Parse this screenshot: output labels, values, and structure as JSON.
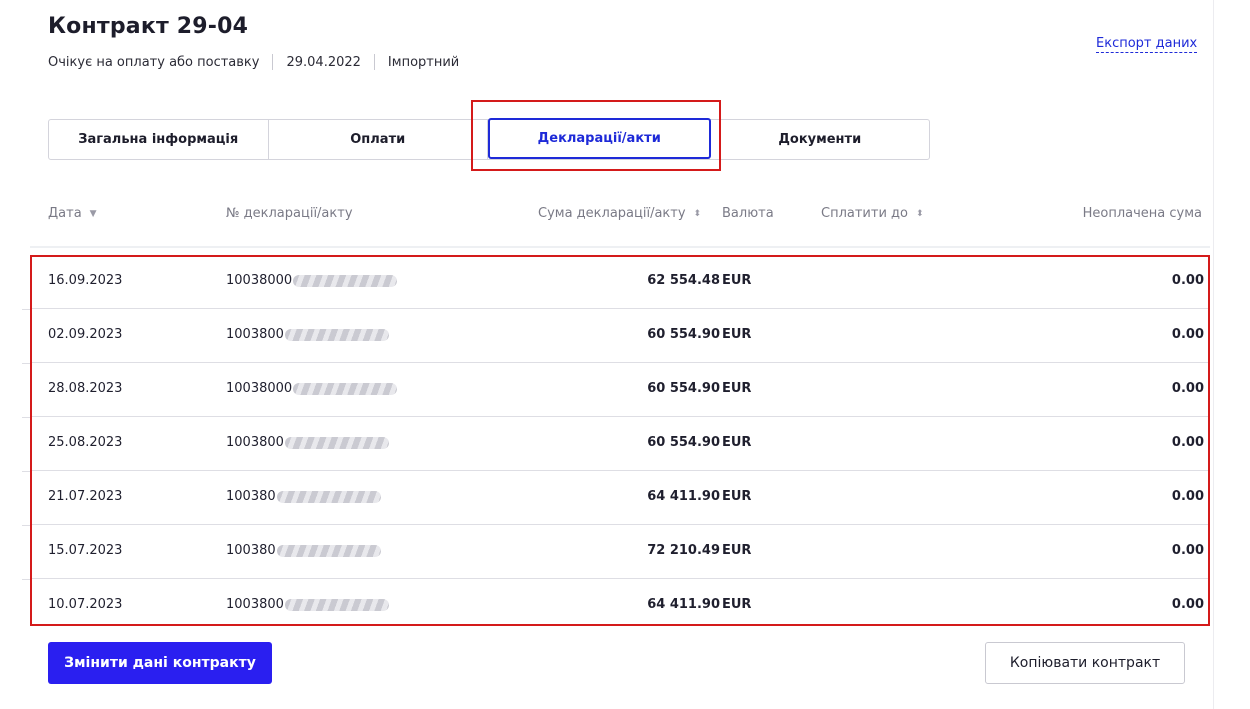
{
  "header": {
    "title": "Контракт 29-04",
    "status": "Очікує на оплату або поставку",
    "date": "29.04.2022",
    "type": "Імпортний",
    "export_label": "Експорт даних"
  },
  "tabs": [
    {
      "label": "Загальна інформація",
      "active": false
    },
    {
      "label": "Оплати",
      "active": false
    },
    {
      "label": "Декларації/акти",
      "active": true
    },
    {
      "label": "Документи",
      "active": false
    }
  ],
  "table": {
    "columns": {
      "date": "Дата",
      "number": "№ декларації/акту",
      "sum": "Сума декларації/акту",
      "currency": "Валюта",
      "pay_until": "Сплатити до",
      "unpaid": "Неоплачена сума"
    },
    "rows": [
      {
        "date": "16.09.2023",
        "number_prefix": "10038000",
        "sum": "62 554.48",
        "currency": "EUR",
        "pay_until": "",
        "unpaid": "0.00"
      },
      {
        "date": "02.09.2023",
        "number_prefix": "1003800",
        "sum": "60 554.90",
        "currency": "EUR",
        "pay_until": "",
        "unpaid": "0.00"
      },
      {
        "date": "28.08.2023",
        "number_prefix": "10038000",
        "sum": "60 554.90",
        "currency": "EUR",
        "pay_until": "",
        "unpaid": "0.00"
      },
      {
        "date": "25.08.2023",
        "number_prefix": "1003800",
        "sum": "60 554.90",
        "currency": "EUR",
        "pay_until": "",
        "unpaid": "0.00"
      },
      {
        "date": "21.07.2023",
        "number_prefix": "100380",
        "sum": "64 411.90",
        "currency": "EUR",
        "pay_until": "",
        "unpaid": "0.00"
      },
      {
        "date": "15.07.2023",
        "number_prefix": "100380",
        "sum": "72 210.49",
        "currency": "EUR",
        "pay_until": "",
        "unpaid": "0.00"
      },
      {
        "date": "10.07.2023",
        "number_prefix": "1003800",
        "sum": "64 411.90",
        "currency": "EUR",
        "pay_until": "",
        "unpaid": "0.00"
      }
    ]
  },
  "actions": {
    "edit_label": "Змінити дані контракту",
    "copy_label": "Копіювати контракт"
  },
  "colors": {
    "accent": "#1e2ad8",
    "primary_button": "#2a1ff0",
    "highlight": "#d41a1a"
  }
}
